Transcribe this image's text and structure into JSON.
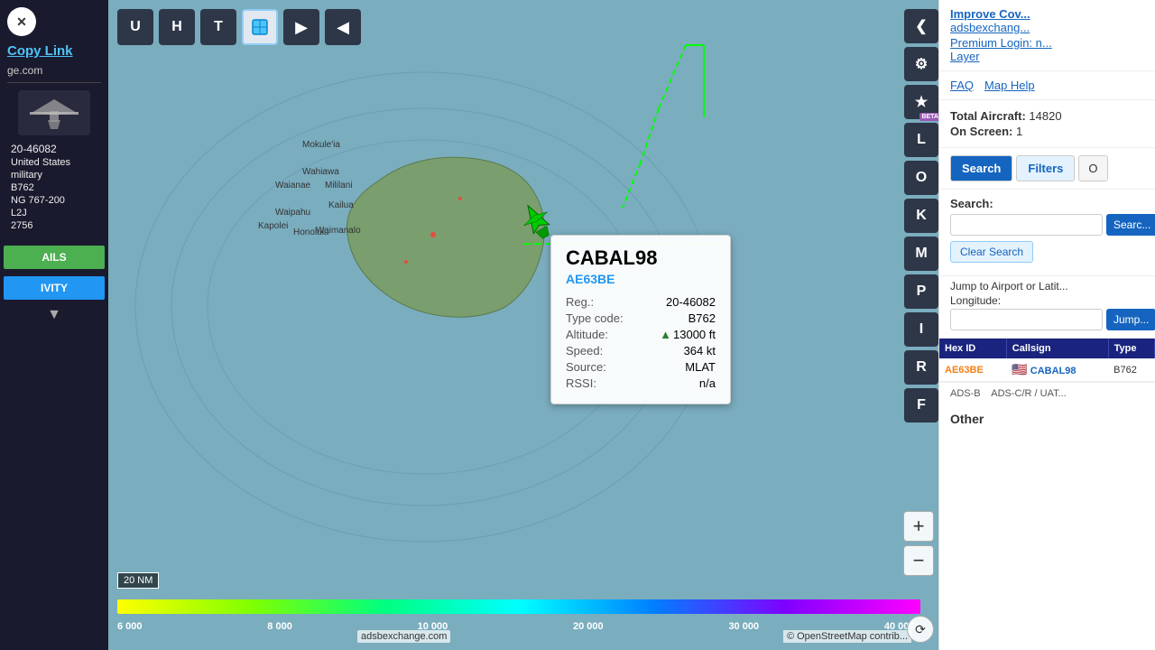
{
  "left_panel": {
    "copy_link_label": "Copy Link",
    "domain": "ge.com",
    "reg": "20-46082",
    "country": "United States",
    "category": "military",
    "type_code": "B762",
    "ac_type": "NG 767-200",
    "squawk": "L2J",
    "flight_num": "2756",
    "details_btn": "AILS",
    "activity_btn": "IVITY",
    "close_icon": "✕"
  },
  "map": {
    "scale_label": "20 NM",
    "attribution": "adsbexchange.com",
    "osm_attribution": "© OpenStreetMap contrib...",
    "color_bar_labels": [
      "6 000",
      "8 000",
      "10 000",
      "20 000",
      "30 000",
      "40 000+"
    ],
    "zoom_in": "+",
    "zoom_out": "−"
  },
  "toolbar": {
    "btn_u": "U",
    "btn_h": "H",
    "btn_t": "T",
    "btn_next": "▶",
    "btn_prev": "◀",
    "btn_left_arrow": "❮",
    "btn_gear": "⚙",
    "btn_star": "★",
    "btn_l": "L",
    "btn_o": "O",
    "btn_k": "K",
    "btn_m": "M",
    "btn_p": "P",
    "btn_i": "I",
    "btn_r": "R",
    "btn_f": "F",
    "beta_label": "BETA"
  },
  "aircraft_popup": {
    "callsign": "CABAL98",
    "hex_id": "AE63BE",
    "reg_label": "Reg.:",
    "reg_value": "20-46082",
    "type_label": "Type code:",
    "type_value": "B762",
    "altitude_label": "Altitude:",
    "altitude_arrow": "▲",
    "altitude_value": "13000 ft",
    "speed_label": "Speed:",
    "speed_value": "364 kt",
    "source_label": "Source:",
    "source_value": "MLAT",
    "rssi_label": "RSSI:",
    "rssi_value": "n/a"
  },
  "right_panel": {
    "improve_cov": "Improve Cov...",
    "adsbexchange": "adsbexchang...",
    "premium_login": "Premium Login: n...",
    "layer": "Layer",
    "faq": "FAQ",
    "map_help": "Map Help",
    "total_aircraft_label": "Total Aircraft:",
    "total_aircraft_value": "14820",
    "on_screen_label": "On Screen:",
    "on_screen_value": "1",
    "tabs": {
      "search": "Search",
      "filters": "Filters",
      "other_abbrev": "O"
    },
    "search_section": {
      "label": "Search:",
      "placeholder": "",
      "search_btn": "Searc...",
      "clear_btn": "Clear Search"
    },
    "jump_section": {
      "label": "Jump to Airport or Latit...",
      "longitude_label": "Longitude:",
      "placeholder": "",
      "jump_btn": "Jump..."
    },
    "table": {
      "headers": [
        "Hex ID",
        "Callsign",
        "Type"
      ],
      "rows": [
        {
          "hex": "AE63BE",
          "flag": "🇺🇸",
          "callsign": "CABAL98",
          "type": "B762"
        }
      ]
    },
    "source_labels": [
      "ADS-B",
      "ADS-C/R / UAT..."
    ],
    "other_label": "Other"
  }
}
